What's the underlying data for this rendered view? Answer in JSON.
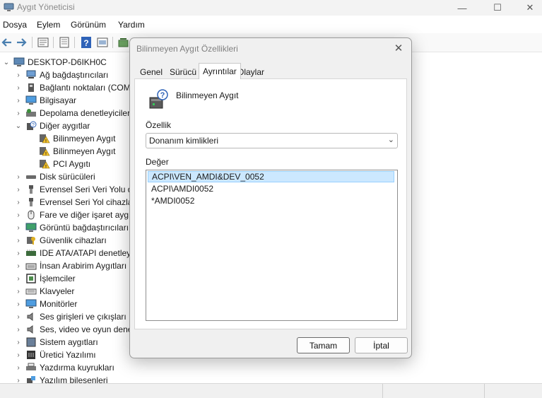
{
  "window": {
    "title": "Aygıt Yöneticisi",
    "minimize_glyph": "—",
    "maximize_glyph": "☐",
    "close_glyph": "✕"
  },
  "menu": [
    "Dosya",
    "Eylem",
    "Görünüm",
    "Yardım"
  ],
  "toolbar": {
    "icons": [
      "back-icon",
      "forward-icon",
      "properties-icon",
      "driver-icon",
      "help-icon",
      "view-icon",
      "scan-icon"
    ]
  },
  "tree": {
    "root": "DESKTOP-D6IKH0C",
    "items": [
      {
        "label": "Ağ bağdaştırıcıları",
        "icon": "network-adapter-icon",
        "expanded": false
      },
      {
        "label": "Bağlantı noktaları (COM",
        "icon": "port-icon",
        "expanded": false
      },
      {
        "label": "Bilgisayar",
        "icon": "computer-icon",
        "expanded": false
      },
      {
        "label": "Depolama denetleyiciler",
        "icon": "storage-controller-icon",
        "expanded": false
      },
      {
        "label": "Diğer aygıtlar",
        "icon": "unknown-device-icon",
        "expanded": true
      },
      {
        "label": "Bilinmeyen Aygıt",
        "icon": "warning-device-icon",
        "child": true
      },
      {
        "label": "Bilinmeyen Aygıt",
        "icon": "warning-device-icon",
        "child": true
      },
      {
        "label": "PCI Aygıtı",
        "icon": "warning-device-icon",
        "child": true
      },
      {
        "label": "Disk sürücüleri",
        "icon": "disk-drive-icon",
        "expanded": false
      },
      {
        "label": "Evrensel Seri Veri Yolu de",
        "icon": "usb-icon",
        "expanded": false
      },
      {
        "label": "Evrensel Seri Yol cihazlar",
        "icon": "usb-icon",
        "expanded": false
      },
      {
        "label": "Fare ve diğer işaret aygıt",
        "icon": "mouse-icon",
        "expanded": false
      },
      {
        "label": "Görüntü bağdaştırıcıları",
        "icon": "display-adapter-icon",
        "expanded": false
      },
      {
        "label": "Güvenlik cihazları",
        "icon": "security-device-icon",
        "expanded": false
      },
      {
        "label": "IDE ATA/ATAPI denetley",
        "icon": "ide-controller-icon",
        "expanded": false
      },
      {
        "label": "İnsan Arabirim Aygıtları",
        "icon": "hid-icon",
        "expanded": false
      },
      {
        "label": "İşlemciler",
        "icon": "processor-icon",
        "expanded": false
      },
      {
        "label": "Klavyeler",
        "icon": "keyboard-icon",
        "expanded": false
      },
      {
        "label": "Monitörler",
        "icon": "monitor-icon",
        "expanded": false
      },
      {
        "label": "Ses girişleri ve çıkışları",
        "icon": "speaker-icon",
        "expanded": false
      },
      {
        "label": "Ses, video ve oyun dene",
        "icon": "speaker-icon",
        "expanded": false
      },
      {
        "label": "Sistem aygıtları",
        "icon": "system-device-icon",
        "expanded": false
      },
      {
        "label": "Üretici Yazılımı",
        "icon": "firmware-icon",
        "expanded": false
      },
      {
        "label": "Yazdırma kuyrukları",
        "icon": "printer-icon",
        "expanded": false
      },
      {
        "label": "Yazılım bileşenleri",
        "icon": "software-component-icon",
        "expanded": false
      }
    ]
  },
  "dialog": {
    "title": "Bilinmeyen Aygıt Özellikleri",
    "close_glyph": "✕",
    "tabs": [
      "Genel",
      "Sürücü",
      "Ayrıntılar",
      "Olaylar"
    ],
    "active_tab": "Ayrıntılar",
    "device_name": "Bilinmeyen Aygıt",
    "property_label": "Özellik",
    "property_value": "Donanım kimlikleri",
    "value_label": "Değer",
    "values": [
      "ACPI\\VEN_AMDI&DEV_0052",
      "ACPI\\AMDI0052",
      "*AMDI0052"
    ],
    "selected_value_index": 0,
    "ok_label": "Tamam",
    "cancel_label": "İptal"
  },
  "colors": {
    "accent": "#0078d4",
    "selection_bg": "#cce8ff",
    "warning": "#f2c12e"
  }
}
